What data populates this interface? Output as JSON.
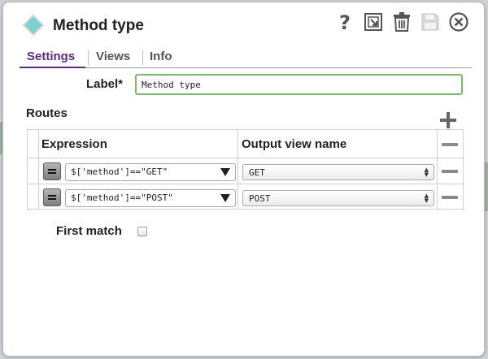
{
  "dialog": {
    "title": "Method type",
    "icons": {
      "header": "snap-diamond-icon",
      "help": "help-icon",
      "export": "export-icon",
      "delete": "trash-icon",
      "save": "save-icon",
      "close": "close-icon"
    }
  },
  "tabs": [
    {
      "label": "Settings",
      "active": true
    },
    {
      "label": "Views",
      "active": false
    },
    {
      "label": "Info",
      "active": false
    }
  ],
  "settings": {
    "label_label": "Label*",
    "label_value": "Method type",
    "routes_label": "Routes",
    "columns": {
      "expression": "Expression",
      "output": "Output view name"
    },
    "routes": [
      {
        "expression": "$['method']==\"GET\"",
        "output": "GET"
      },
      {
        "expression": "$['method']==\"POST\"",
        "output": "POST"
      }
    ],
    "first_match_label": "First match",
    "first_match_checked": false
  },
  "colors": {
    "accent": "#5a2b82",
    "input_border": "#84b56e",
    "diamond": "#7fcfcc"
  }
}
